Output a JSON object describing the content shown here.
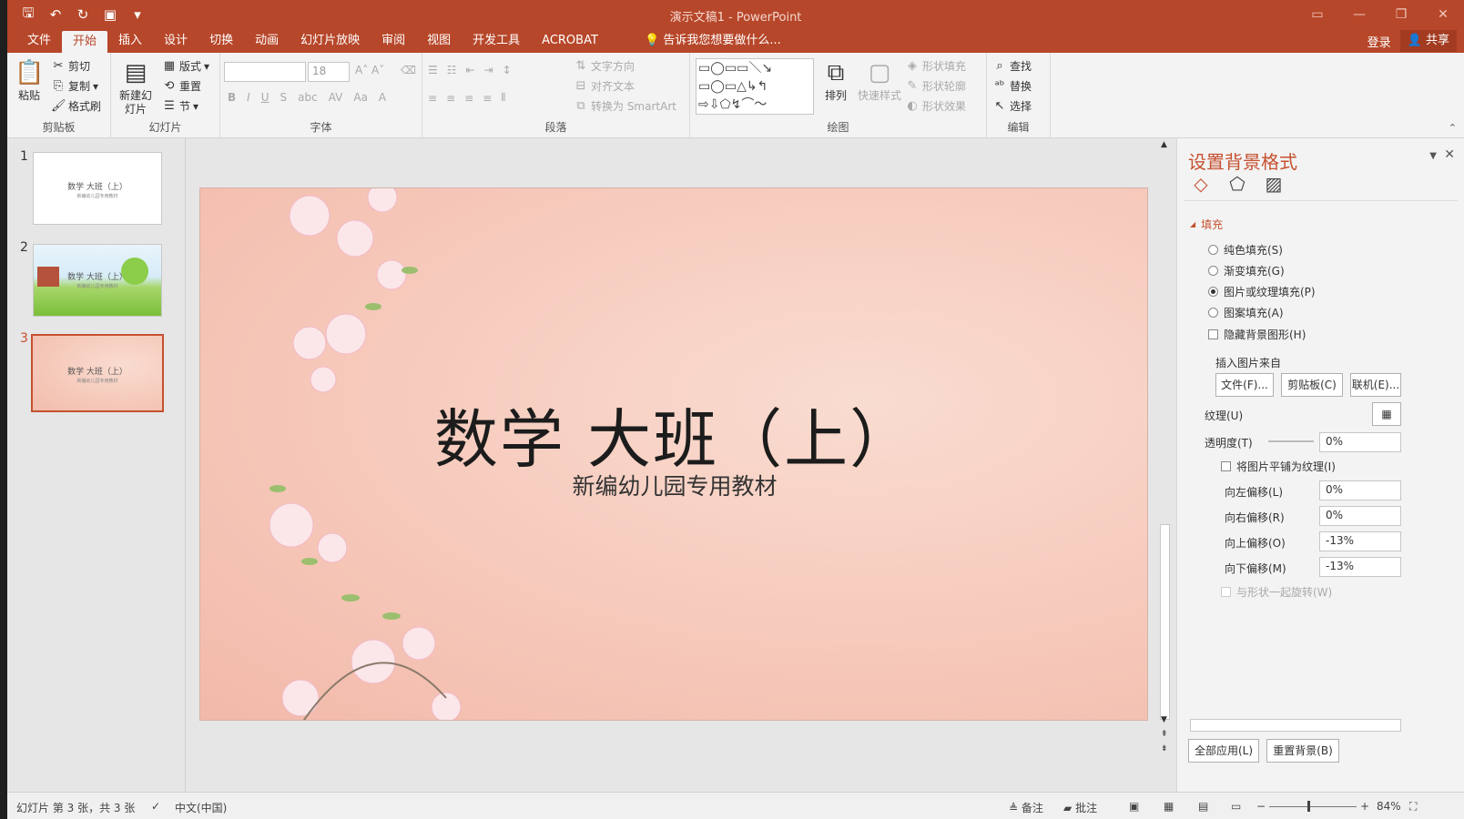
{
  "app": {
    "title": "演示文稿1 - PowerPoint"
  },
  "tabs": [
    "文件",
    "开始",
    "插入",
    "设计",
    "切换",
    "动画",
    "幻灯片放映",
    "审阅",
    "视图",
    "开发工具",
    "ACROBAT"
  ],
  "tell_me": "告诉我您想要做什么...",
  "account": {
    "login": "登录",
    "share": "共享"
  },
  "ribbon": {
    "clipboard": {
      "paste": "粘贴",
      "cut": "剪切",
      "copy": "复制",
      "format_painter": "格式刷",
      "label": "剪贴板"
    },
    "slides": {
      "new_slide": "新建幻灯片",
      "layout": "版式",
      "reset": "重置",
      "section": "节",
      "label": "幻灯片"
    },
    "font": {
      "size": "18",
      "label": "字体"
    },
    "paragraph": {
      "text_direction": "文字方向",
      "align_text": "对齐文本",
      "smartart": "转换为 SmartArt",
      "label": "段落"
    },
    "drawing": {
      "arrange": "排列",
      "quick_styles": "快速样式",
      "shape_fill": "形状填充",
      "shape_outline": "形状轮廓",
      "shape_effects": "形状效果",
      "label": "绘图"
    },
    "editing": {
      "find": "查找",
      "replace": "替换",
      "select": "选择",
      "label": "编辑"
    }
  },
  "thumbnails": [
    {
      "num": "1",
      "title": "数学 大班（上）",
      "subtitle": "新编幼儿园专用教材"
    },
    {
      "num": "2",
      "title": "数学 大班（上）",
      "subtitle": "新编幼儿园专用教材"
    },
    {
      "num": "3",
      "title": "数学 大班（上）",
      "subtitle": "新编幼儿园专用教材"
    }
  ],
  "slide": {
    "title": "数学  大班（上）",
    "subtitle": "新编幼儿园专用教材"
  },
  "format_pane": {
    "title": "设置背景格式",
    "fill_section": "填充",
    "options": [
      "纯色填充(S)",
      "渐变填充(G)",
      "图片或纹理填充(P)",
      "图案填充(A)"
    ],
    "selected_option": "图片或纹理填充(P)",
    "hide_bg": "隐藏背景图形(H)",
    "insert_from": "插入图片来自",
    "file_btn": "文件(F)...",
    "clipboard_btn": "剪贴板(C)",
    "online_btn": "联机(E)...",
    "texture": "纹理(U)",
    "transparency_label": "透明度(T)",
    "transparency": "0%",
    "tile": "将图片平铺为纹理(I)",
    "offset_left_label": "向左偏移(L)",
    "offset_left": "0%",
    "offset_right_label": "向右偏移(R)",
    "offset_right": "0%",
    "offset_top_label": "向上偏移(O)",
    "offset_top": "-13%",
    "offset_bottom_label": "向下偏移(M)",
    "offset_bottom": "-13%",
    "rotate_with_shape": "与形状一起旋转(W)",
    "apply_all": "全部应用(L)",
    "reset_bg": "重置背景(B)"
  },
  "status": {
    "slide_info": "幻灯片 第 3 张，共 3 张",
    "language": "中文(中国)",
    "notes": "备注",
    "comments": "批注",
    "zoom": "84%"
  },
  "colors": {
    "accent": "#b7472a",
    "pane_title": "#c5512f"
  }
}
